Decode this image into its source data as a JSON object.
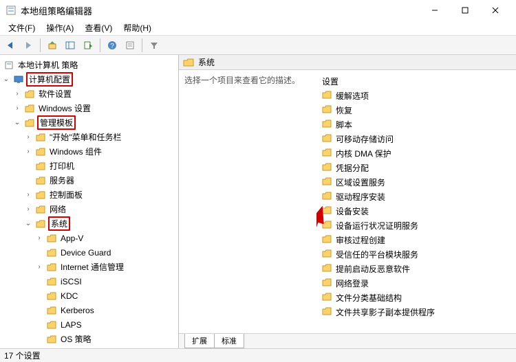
{
  "window": {
    "title": "本地组策略编辑器"
  },
  "menu": {
    "file": "文件(F)",
    "action": "操作(A)",
    "view": "查看(V)",
    "help": "帮助(H)"
  },
  "tree": {
    "root": "本地计算机 策略",
    "computer": "计算机配置",
    "software": "软件设置",
    "windows": "Windows 设置",
    "admin": "管理模板",
    "startmenu": "\"开始\"菜单和任务栏",
    "wincomp": "Windows 组件",
    "printer": "打印机",
    "server": "服务器",
    "controlpanel": "控制面板",
    "network": "网络",
    "system": "系统",
    "appv": "App-V",
    "deviceguard": "Device Guard",
    "internet": "Internet 通信管理",
    "iscsi": "iSCSI",
    "kdc": "KDC",
    "kerberos": "Kerberos",
    "laps": "LAPS",
    "ospolicy": "OS 策略"
  },
  "right": {
    "header": "系统",
    "desc": "选择一个项目来查看它的描述。",
    "heading": "设置",
    "items": [
      "缓解选项",
      "恢复",
      "脚本",
      "可移动存储访问",
      "内核 DMA 保护",
      "凭据分配",
      "区域设置服务",
      "驱动程序安装",
      "设备安装",
      "设备运行状况证明服务",
      "审核过程创建",
      "受信任的平台模块服务",
      "提前启动反恶意软件",
      "网络登录",
      "文件分类基础结构",
      "文件共享影子副本提供程序"
    ],
    "tabs": {
      "extended": "扩展",
      "standard": "标准"
    }
  },
  "status": {
    "text": "17 个设置"
  }
}
